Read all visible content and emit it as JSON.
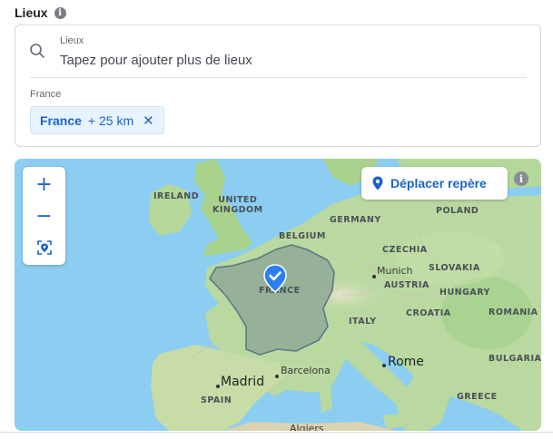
{
  "section": {
    "title": "Lieux",
    "info_glyph": "i"
  },
  "search": {
    "label": "Lieux",
    "placeholder": "Tapez pour ajouter plus de lieux",
    "icon": "search-icon"
  },
  "selected": {
    "group_label": "France",
    "chips": [
      {
        "name": "France",
        "radius": "+ 25 km",
        "remove_glyph": "✕"
      }
    ]
  },
  "map": {
    "zoom_in": "+",
    "zoom_out": "−",
    "move_marker_label": "Déplacer repère",
    "info_glyph": "i",
    "labels": {
      "ireland": "IRELAND",
      "uk": "UNITED\nKINGDOM",
      "germany": "GERMANY",
      "poland": "POLAND",
      "belgium": "BELGIUM",
      "czechia": "CZECHIA",
      "slovakia": "SLOVAKIA",
      "munich": "Munich",
      "austria": "AUSTRIA",
      "hungary": "HUNGARY",
      "france": "FRANCE",
      "croatia": "CROATIA",
      "romania": "ROMANIA",
      "italy": "ITALY",
      "rome": "Rome",
      "bulgaria": "BULGARIA",
      "madrid": "Madrid",
      "barcelona": "Barcelona",
      "spain": "SPAIN",
      "greece": "GREECE",
      "algiers": "Algiers"
    }
  },
  "colors": {
    "accent": "#1a64c9",
    "chip_bg": "#e7f3ff",
    "sea": "#8ccdf2",
    "land": "#b9d9a0"
  }
}
